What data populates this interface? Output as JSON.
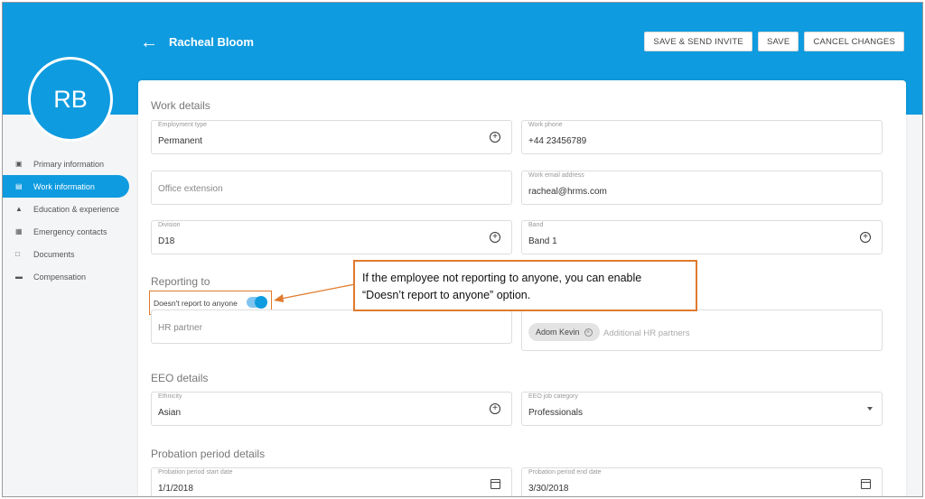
{
  "header": {
    "title": "Racheal Bloom",
    "buttons": {
      "save_send": "SAVE & SEND INVITE",
      "save": "SAVE",
      "cancel": "CANCEL CHANGES"
    }
  },
  "avatar": {
    "initials": "RB"
  },
  "sidebar": {
    "items": [
      {
        "label": "Primary information",
        "icon": "id-card-icon"
      },
      {
        "label": "Work information",
        "icon": "briefcase-icon",
        "active": true
      },
      {
        "label": "Education & experience",
        "icon": "graduation-cap-icon"
      },
      {
        "label": "Emergency contacts",
        "icon": "contact-card-icon"
      },
      {
        "label": "Documents",
        "icon": "folder-icon"
      },
      {
        "label": "Compensation",
        "icon": "credit-card-icon"
      }
    ]
  },
  "work_details": {
    "title": "Work details",
    "employment_type": {
      "label": "Employment type",
      "value": "Permanent"
    },
    "work_phone": {
      "label": "Work phone",
      "value": "+44 23456789"
    },
    "office_extension": {
      "placeholder": "Office extension"
    },
    "work_email": {
      "label": "Work email address",
      "value": "racheal@hrms.com"
    },
    "division": {
      "label": "Division",
      "value": "D18"
    },
    "band": {
      "label": "Band",
      "value": "Band 1"
    }
  },
  "reporting": {
    "title": "Reporting to",
    "toggle_label": "Doesn't report to anyone",
    "toggle_on": true,
    "hr_partner": {
      "placeholder": "HR partner"
    },
    "additional": {
      "chip": "Adom Kevin",
      "placeholder": "Additional HR partners"
    }
  },
  "eeo": {
    "title": "EEO details",
    "ethnicity": {
      "label": "Ethnicity",
      "value": "Asian"
    },
    "job_category": {
      "label": "EEO job category",
      "value": "Professionals"
    }
  },
  "probation": {
    "title": "Probation period details",
    "start": {
      "label": "Probation period start date",
      "value": "1/1/2018"
    },
    "end": {
      "label": "Probation period end date",
      "value": "3/30/2018"
    }
  },
  "callout": {
    "line1": "If the employee not reporting to anyone, you can enable",
    "line2": "“Doesn’t report to anyone” option."
  },
  "colors": {
    "accent": "#0f9bdf",
    "callout_border": "#e07a2d"
  }
}
